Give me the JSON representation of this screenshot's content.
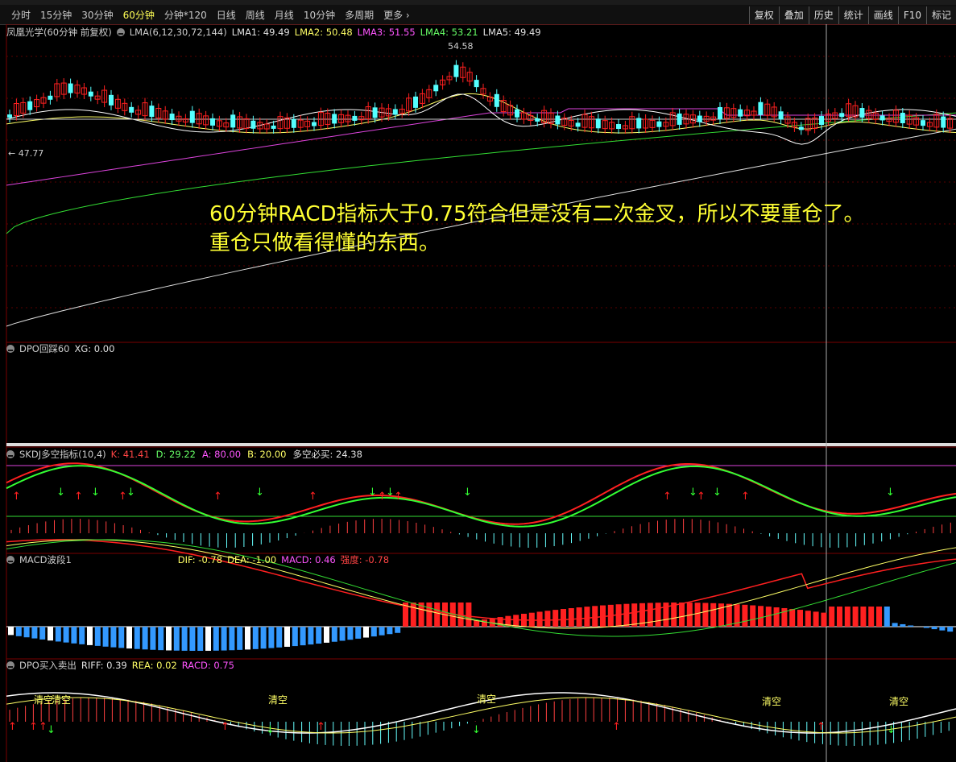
{
  "toolbar": {
    "periods": [
      "分时",
      "15分钟",
      "30分钟",
      "60分钟",
      "分钟*120",
      "日线",
      "周线",
      "月线",
      "10分钟",
      "多周期",
      "更多 ›"
    ],
    "active_period": "60分钟",
    "tools": [
      "复权",
      "叠加",
      "历史",
      "统计",
      "画线",
      "F10",
      "标记"
    ]
  },
  "main_panel": {
    "stock_title": "凤凰光学(60分钟 前复权)",
    "indicator_name": "LMA(6,12,30,72,144)",
    "values": [
      {
        "label": "LMA1: 49.49",
        "color": "#e0e0e0"
      },
      {
        "label": "LMA2: 50.48",
        "color": "#ffff66"
      },
      {
        "label": "LMA3: 51.55",
        "color": "#ff55ff"
      },
      {
        "label": "LMA4: 53.21",
        "color": "#66ff66"
      },
      {
        "label": "LMA5: 49.49",
        "color": "#e0e0e0"
      }
    ],
    "high_label": "54.58",
    "low_label": "← 47.77",
    "annotation_line1": "60分钟RACD指标大于0.75符合但是没有二次金叉，所以不要重仓了。",
    "annotation_line2": "重仓只做看得懂的东西。"
  },
  "dpo_panel": {
    "title": "DPO回踩60",
    "values": [
      {
        "label": "XG: 0.00",
        "color": "#e0e0e0"
      }
    ]
  },
  "skdj_panel": {
    "title": "SKDJ多空指标(10,4)",
    "values": [
      {
        "label": "K: 41.41",
        "color": "#ff4444"
      },
      {
        "label": "D: 29.22",
        "color": "#66ff66"
      },
      {
        "label": "A: 80.00",
        "color": "#ff55ff"
      },
      {
        "label": "B: 20.00",
        "color": "#ffff66"
      },
      {
        "label": "多空必买: 24.38",
        "color": "#e0e0e0"
      }
    ]
  },
  "macd_panel": {
    "title": "MACD波段1",
    "values": [
      {
        "label": "DIF: -0.78",
        "color": "#ffff66"
      },
      {
        "label": "DEA: -1.00",
        "color": "#ffff66"
      },
      {
        "label": "MACD: 0.46",
        "color": "#ff55ff"
      },
      {
        "label": "强度: -0.78",
        "color": "#ff4444"
      }
    ]
  },
  "dpo_trade_panel": {
    "title": "DPO买入卖出",
    "values": [
      {
        "label": "RIFF: 0.39",
        "color": "#e0e0e0"
      },
      {
        "label": "REA: 0.02",
        "color": "#ffff66"
      },
      {
        "label": "RACD: 0.75",
        "color": "#ff55ff"
      }
    ],
    "clear_label": "清空"
  },
  "colors": {
    "up": "#ff2020",
    "down": "#55ffff",
    "dif": "#ffffff",
    "dea": "#ffff66",
    "accent_active": "#ffff55"
  }
}
